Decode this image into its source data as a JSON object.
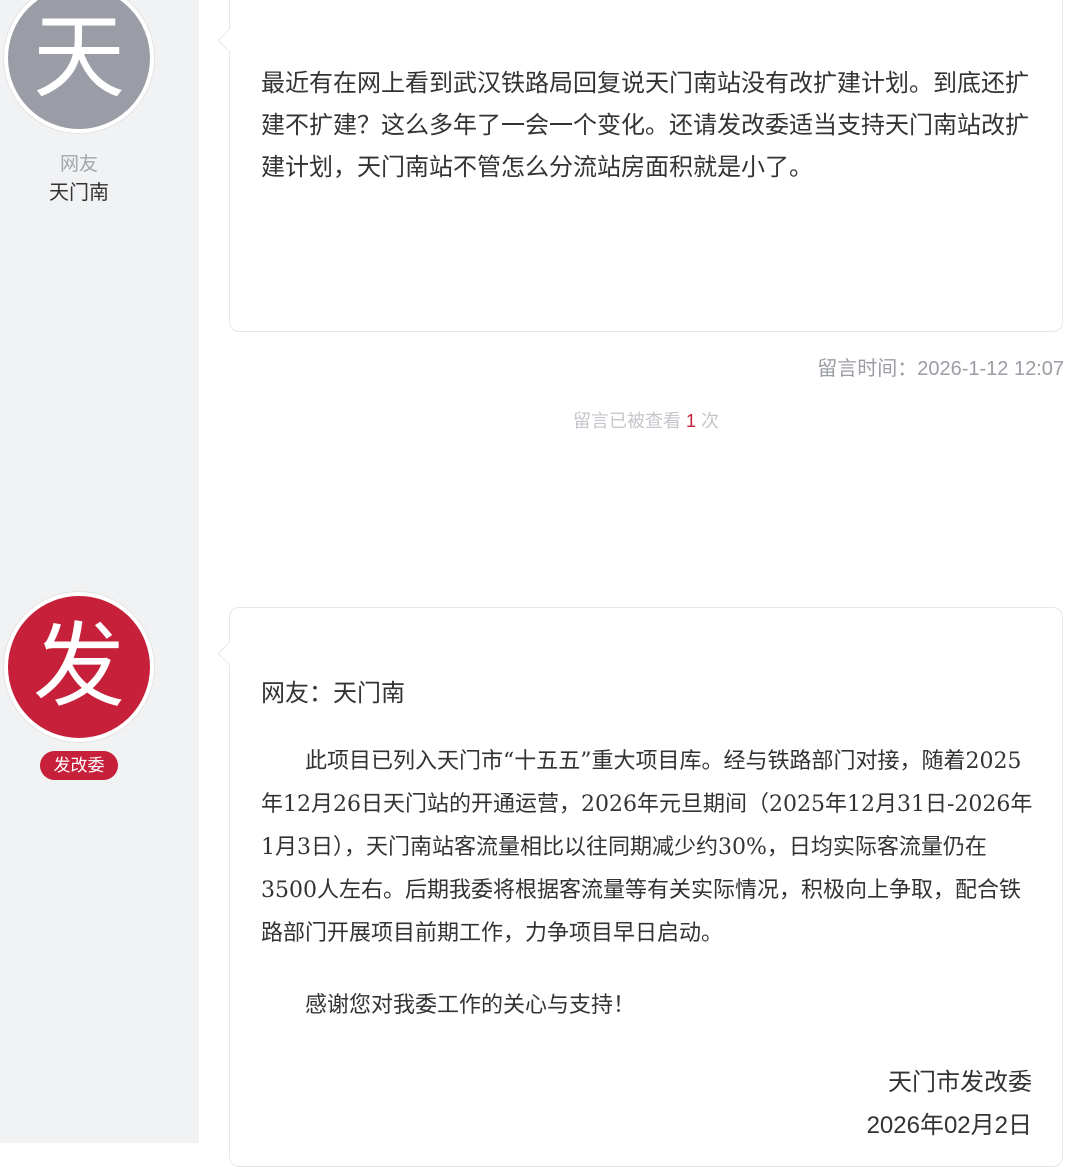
{
  "question": {
    "avatar_char": "天",
    "author_role": "网友",
    "author_name": "天门南",
    "content": "最近有在网上看到武汉铁路局回复说天门南站没有改扩建计划。到底还扩建不扩建？这么多年了一会一个变化。还请发改委适当支持天门南站改扩建计划，天门南站不管怎么分流站房面积就是小了。",
    "time_label": "留言时间：2026-1-12 12:07",
    "views_prefix": "留言已被查看",
    "views_count": "1",
    "views_suffix": "次"
  },
  "reply": {
    "avatar_char": "发",
    "dept_badge": "发改委",
    "addressee": "网友：天门南",
    "paragraph1": "此项目已列入天门市“十五五”重大项目库。经与铁路部门对接，随着2025年12月26日天门站的开通运营，2026年元旦期间（2025年12月31日-2026年1月3日），天门南站客流量相比以往同期减少约30%，日均实际客流量仍在3500人左右。后期我委将根据客流量等有关实际情况，积极向上争取，配合铁路部门开展项目前期工作，力争项目早日启动。",
    "paragraph2": "感谢您对我委工作的关心与支持！",
    "signature_org": "天门市发改委",
    "signature_date": "2026年02月2日"
  },
  "colors": {
    "accent_red": "#c6203a",
    "avatar_gray": "#9a9da6",
    "sidebar_bg": "#f1f2f4"
  }
}
